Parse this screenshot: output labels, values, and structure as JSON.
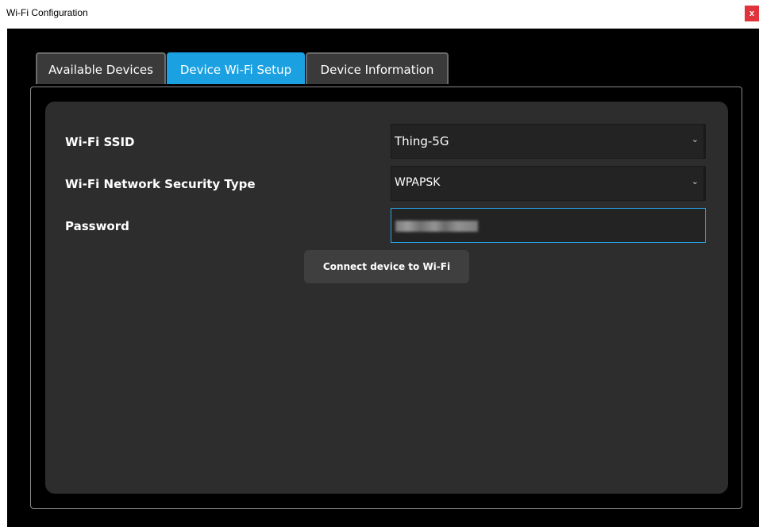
{
  "window": {
    "title": "Wi-Fi Configuration",
    "close_label": "x"
  },
  "tabs": [
    {
      "label": "Available Devices",
      "active": false
    },
    {
      "label": "Device Wi-Fi Setup",
      "active": true
    },
    {
      "label": "Device Information",
      "active": false
    }
  ],
  "form": {
    "ssid_label": "Wi-Fi SSID",
    "ssid_value": "Thing-5G",
    "security_label": "Wi-Fi Network Security Type",
    "security_value": "WPAPSK",
    "password_label": "Password",
    "connect_label": "Connect device to Wi-Fi"
  },
  "colors": {
    "accent": "#1ba1e2",
    "close": "#e0343c",
    "panel": "#2d2d2d",
    "background": "#000000"
  },
  "icons": {
    "dropdown": "chevron-down-icon"
  }
}
